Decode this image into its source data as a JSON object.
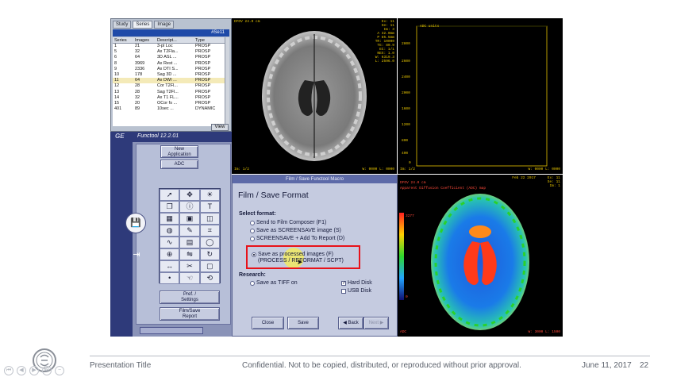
{
  "series_panel": {
    "tabs": [
      "Study",
      "Series",
      "Image"
    ],
    "selected_series": "#Se11",
    "columns": [
      "Series",
      "Images",
      "Descript...",
      "Type"
    ],
    "rows": [
      [
        "1",
        "21",
        "3-pl Loc",
        "PROSP"
      ],
      [
        "5",
        "32",
        "Ax T2Fla...",
        "PROSP"
      ],
      [
        "6",
        "64",
        "3D ASL ...",
        "PROSP"
      ],
      [
        "8",
        "3969",
        "Ax Rest ...",
        "PROSP"
      ],
      [
        "9",
        "2336",
        "Ax DTI S...",
        "PROSP"
      ],
      [
        "10",
        "178",
        "Sag 3D ...",
        "PROSP"
      ],
      [
        "11",
        "64",
        "Ax DWI ...",
        "PROSP"
      ],
      [
        "12",
        "28",
        "Cor T2Fl...",
        "PROSP"
      ],
      [
        "13",
        "28",
        "Sag T2Fl...",
        "PROSP"
      ],
      [
        "14",
        "32",
        "Ax T1 FL...",
        "PROSP"
      ],
      [
        "15",
        "20",
        "OCor fs ...",
        "PROSP"
      ],
      [
        "401",
        "89",
        "10sec ...",
        "DYNAMIC"
      ]
    ],
    "selected_row_index": 6,
    "view_label": "View"
  },
  "tool_panel": {
    "app_name": "Functool 12.2.01",
    "new_application_label": "New\nApplication",
    "adc_label": "ADC",
    "prefs_label": "Pref. /\nSettings",
    "filmsave_label": "Film/Save\nReport",
    "tools": [
      "arrow-icon",
      "move-icon",
      "brightness-icon",
      "copy-icon",
      "info-icon",
      "text-icon",
      "grid-icon",
      "layout-icon",
      "roi-icon",
      "compass-icon",
      "annotate-icon",
      "crop-icon",
      "curve-icon",
      "film-icon",
      "ellipse-icon"
    ]
  },
  "viewport_top_left": {
    "header": "DFOV 24.0 cm",
    "info_right": [
      "Ex: 11",
      "Se: 11",
      "Im: 3",
      "A 32.0mm",
      "P 85.5mm",
      "TR: 10000",
      "TE: 80.9",
      "EC: 1/1",
      "NEX: 1.0",
      "W: 6319.3",
      "L: 2596.0"
    ],
    "footer_left": "Im: 1/2",
    "footer_right": "W: 0000 L: 0000"
  },
  "viewport_top_right": {
    "series_label": "ADC units",
    "y_ticks": [
      "2800",
      "2600",
      "2400",
      "2000",
      "1600",
      "1200",
      "800",
      "400",
      "0"
    ],
    "footer_left": "Im: 1/2",
    "footer_right": "W: 0000 L: 0000"
  },
  "viewport_bottom_right": {
    "date": "Feb 22 2017",
    "info_right": [
      "Ex: 11",
      "Se: 11",
      "Im: 1"
    ],
    "header_line1": "DFOV 24.0 cm",
    "header_line2": "Apparent Diffusion Coefficient (ADC) map",
    "colorbar_top": "3277",
    "colorbar_bottom": "0",
    "footer_left": "ADC",
    "footer_right": "W: 3000 L: 1500"
  },
  "dialog": {
    "title_bar": "Film / Save Functool Macro",
    "heading": "Film / Save Format",
    "select_format_label": "Select format:",
    "options": [
      "Send to Film Composer (F1)",
      "Save as SCREENSAVE image (S)",
      "SCREENSAVE + Add To Report (D)"
    ],
    "highlighted_option_line1": "Save as processed images (F)",
    "highlighted_option_line2": "(PROCESS / REFORMAT / SCPT)",
    "research_label": "Research:",
    "tiff_option": "Save as TIFF on",
    "hard_disk_label": "Hard Disk",
    "usb_disk_label": "USB Disk",
    "hard_disk_checked": "✓",
    "close_label": "Close",
    "save_label": "Save",
    "back_label": "Back",
    "next_label": "Next"
  },
  "footer": {
    "title": "Presentation Title",
    "confidential": "Confidential. Not to be copied, distributed, or reproduced without prior approval.",
    "date": "June 11, 2017",
    "page": "22"
  },
  "colors": {
    "highlight_border": "#e8121a",
    "panel_blue": "#2e3a7a",
    "selection_bar": "#1f4aa8"
  }
}
